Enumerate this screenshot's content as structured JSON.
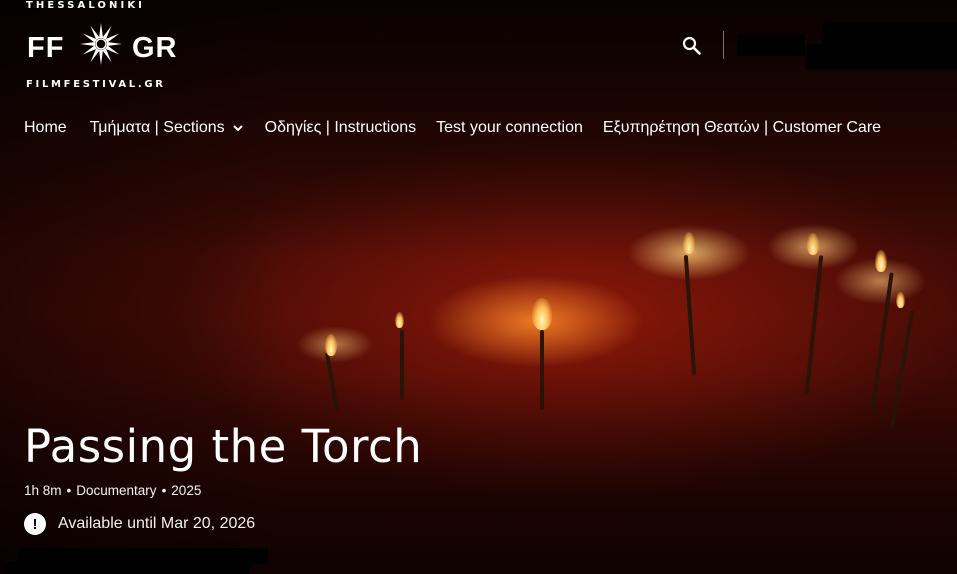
{
  "header": {
    "logo": {
      "city": "THESSALONIKI",
      "left_letters": "FF",
      "right_letters": "GR",
      "site": "FILMFESTIVAL.GR"
    },
    "search_icon": "search-icon"
  },
  "nav": {
    "items": [
      {
        "label": "Home"
      },
      {
        "label": "Τμήματα | Sections",
        "has_dropdown": true
      },
      {
        "label": "Οδηγίες | Instructions"
      },
      {
        "label": "Test your connection"
      },
      {
        "label": "Εξυπηρέτηση Θεατών | Customer Care"
      }
    ]
  },
  "film": {
    "title": "Passing the Torch",
    "duration": "1h 8m",
    "genre": "Documentary",
    "year": "2025",
    "separator": "•",
    "availability": "Available until Mar 20, 2026",
    "availability_icon_glyph": "!"
  },
  "colors": {
    "text": "#ffffff",
    "hero_tint": "#6a1208",
    "flame": "#ffc257"
  }
}
